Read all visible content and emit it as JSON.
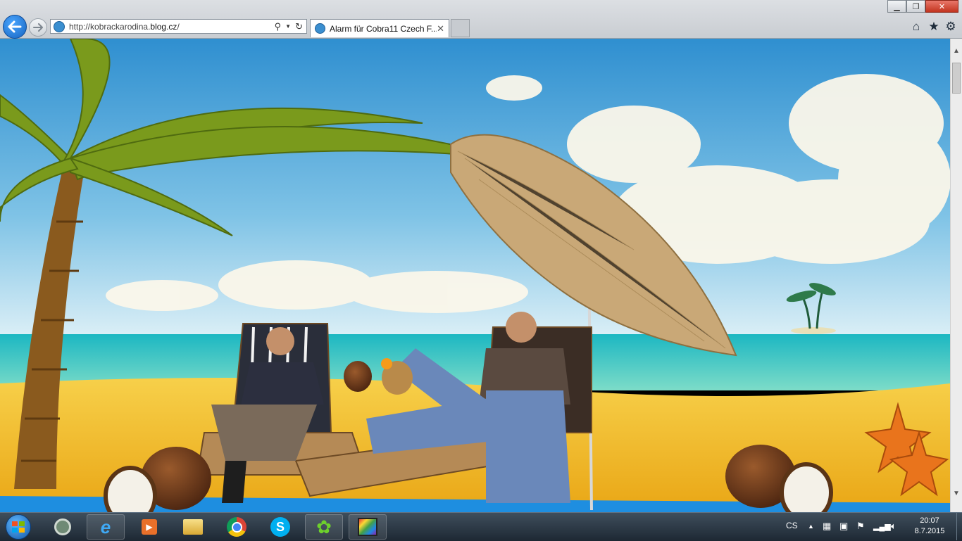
{
  "browser": {
    "url_prefix": "http://kobrackarodina.",
    "url_host": "blog.cz",
    "url_suffix": "/",
    "tab_title": "Alarm für Cobra11 Czech F...",
    "icons": [
      "back-arrow-icon",
      "forward-arrow-icon",
      "site-favicon",
      "search-icon",
      "dropdown-icon",
      "refresh-icon",
      "tab-close-icon",
      "home-icon",
      "favorites-star-icon",
      "settings-gear-icon",
      "minimize-icon",
      "restore-icon",
      "close-icon"
    ]
  },
  "taskbar": {
    "apps": [
      "start-button",
      "power-tool",
      "internet-explorer",
      "media-player",
      "file-explorer",
      "chrome",
      "skype",
      "icq",
      "media-app"
    ],
    "language": "CS",
    "time": "20:07",
    "date": "8.7.2015",
    "tray_icons": [
      "show-hidden-icons",
      "action-center",
      "network-icon",
      "flag-icon",
      "signal-bars-icon",
      "volume-icon"
    ]
  },
  "colors": {
    "ie_blue": "#1b78d8",
    "sky": "#4aa7d9",
    "sea": "#2fc3b8",
    "sand": "#f4c42e"
  }
}
